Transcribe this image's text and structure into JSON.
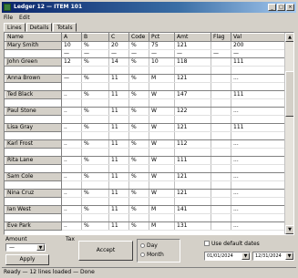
{
  "window": {
    "title": "Ledger 12 — ITEM 101"
  },
  "titlebar_buttons": [
    "_",
    "□",
    "×"
  ],
  "menu": [
    "File",
    "Edit"
  ],
  "tabs": [
    "Lines",
    "Details",
    "Totals"
  ],
  "table": {
    "columns": [
      "Name",
      "A",
      "B",
      "C",
      "Code",
      "Pct",
      "Amt",
      "Flag",
      "Val"
    ],
    "rows": [
      [
        "Mary Smith",
        "10",
        "%",
        "20",
        "%",
        "75",
        "121",
        "",
        "200"
      ],
      [
        "",
        "—",
        "—",
        "—",
        "—",
        "—",
        "—",
        "—",
        "—"
      ],
      [
        "John Green",
        "12",
        "%",
        "14",
        "%",
        "10",
        "118",
        "",
        "111"
      ],
      [
        "",
        "",
        "",
        "",
        "",
        "",
        "",
        "",
        ""
      ],
      [
        "Anna Brown",
        "—",
        "%",
        "11",
        "%",
        "M",
        "121",
        "",
        "..."
      ],
      [
        "",
        "",
        "",
        "",
        "",
        "",
        "",
        "",
        ""
      ],
      [
        "Ted Black",
        "..",
        "%",
        "11",
        "%",
        "W",
        "147",
        "",
        "111"
      ],
      [
        "",
        "",
        "",
        "",
        "",
        "",
        "",
        "",
        ""
      ],
      [
        "Paul Stone",
        "..",
        "%",
        "11",
        "%",
        "W",
        "122",
        "",
        "..."
      ],
      [
        "",
        "",
        "",
        "",
        "",
        "",
        "",
        "",
        ""
      ],
      [
        "Lisa Gray",
        "..",
        "%",
        "11",
        "%",
        "W",
        "121",
        "",
        "111"
      ],
      [
        "",
        "",
        "",
        "",
        "",
        "",
        "",
        "",
        ""
      ],
      [
        "Karl Frost",
        "..",
        "%",
        "11",
        "%",
        "W",
        "112",
        "",
        "..."
      ],
      [
        "",
        "",
        "",
        "",
        "",
        "",
        "",
        "",
        ""
      ],
      [
        "Rita Lane",
        "..",
        "%",
        "11",
        "%",
        "W",
        "111",
        "",
        "..."
      ],
      [
        "",
        "",
        "",
        "",
        "",
        "",
        "",
        "",
        ""
      ],
      [
        "Sam Cole",
        "..",
        "%",
        "11",
        "%",
        "W",
        "121",
        "",
        "..."
      ],
      [
        "",
        "",
        "",
        "",
        "",
        "",
        "",
        "",
        ""
      ],
      [
        "Nina Cruz",
        "..",
        "%",
        "11",
        "%",
        "W",
        "121",
        "",
        "..."
      ],
      [
        "",
        "",
        "",
        "",
        "",
        "",
        "",
        "",
        ""
      ],
      [
        "Ian West",
        "..",
        "%",
        "11",
        "%",
        "M",
        "141",
        "",
        "..."
      ],
      [
        "",
        "",
        "",
        "",
        "",
        "",
        "",
        "",
        ""
      ],
      [
        "Eve Park",
        "..",
        "%",
        "11",
        "%",
        "M",
        "131",
        "",
        "..."
      ]
    ]
  },
  "bottom": {
    "label1": "Amount",
    "label2": "Tax",
    "combo_value": "—",
    "apply_label": "Apply",
    "accept_label": "Accept",
    "radio1": "Day",
    "radio2": "Month",
    "check_label": "Use default dates",
    "date_from": "01/01/2024",
    "date_to": "12/31/2024"
  },
  "status": "Ready — 12 lines loaded — Done"
}
